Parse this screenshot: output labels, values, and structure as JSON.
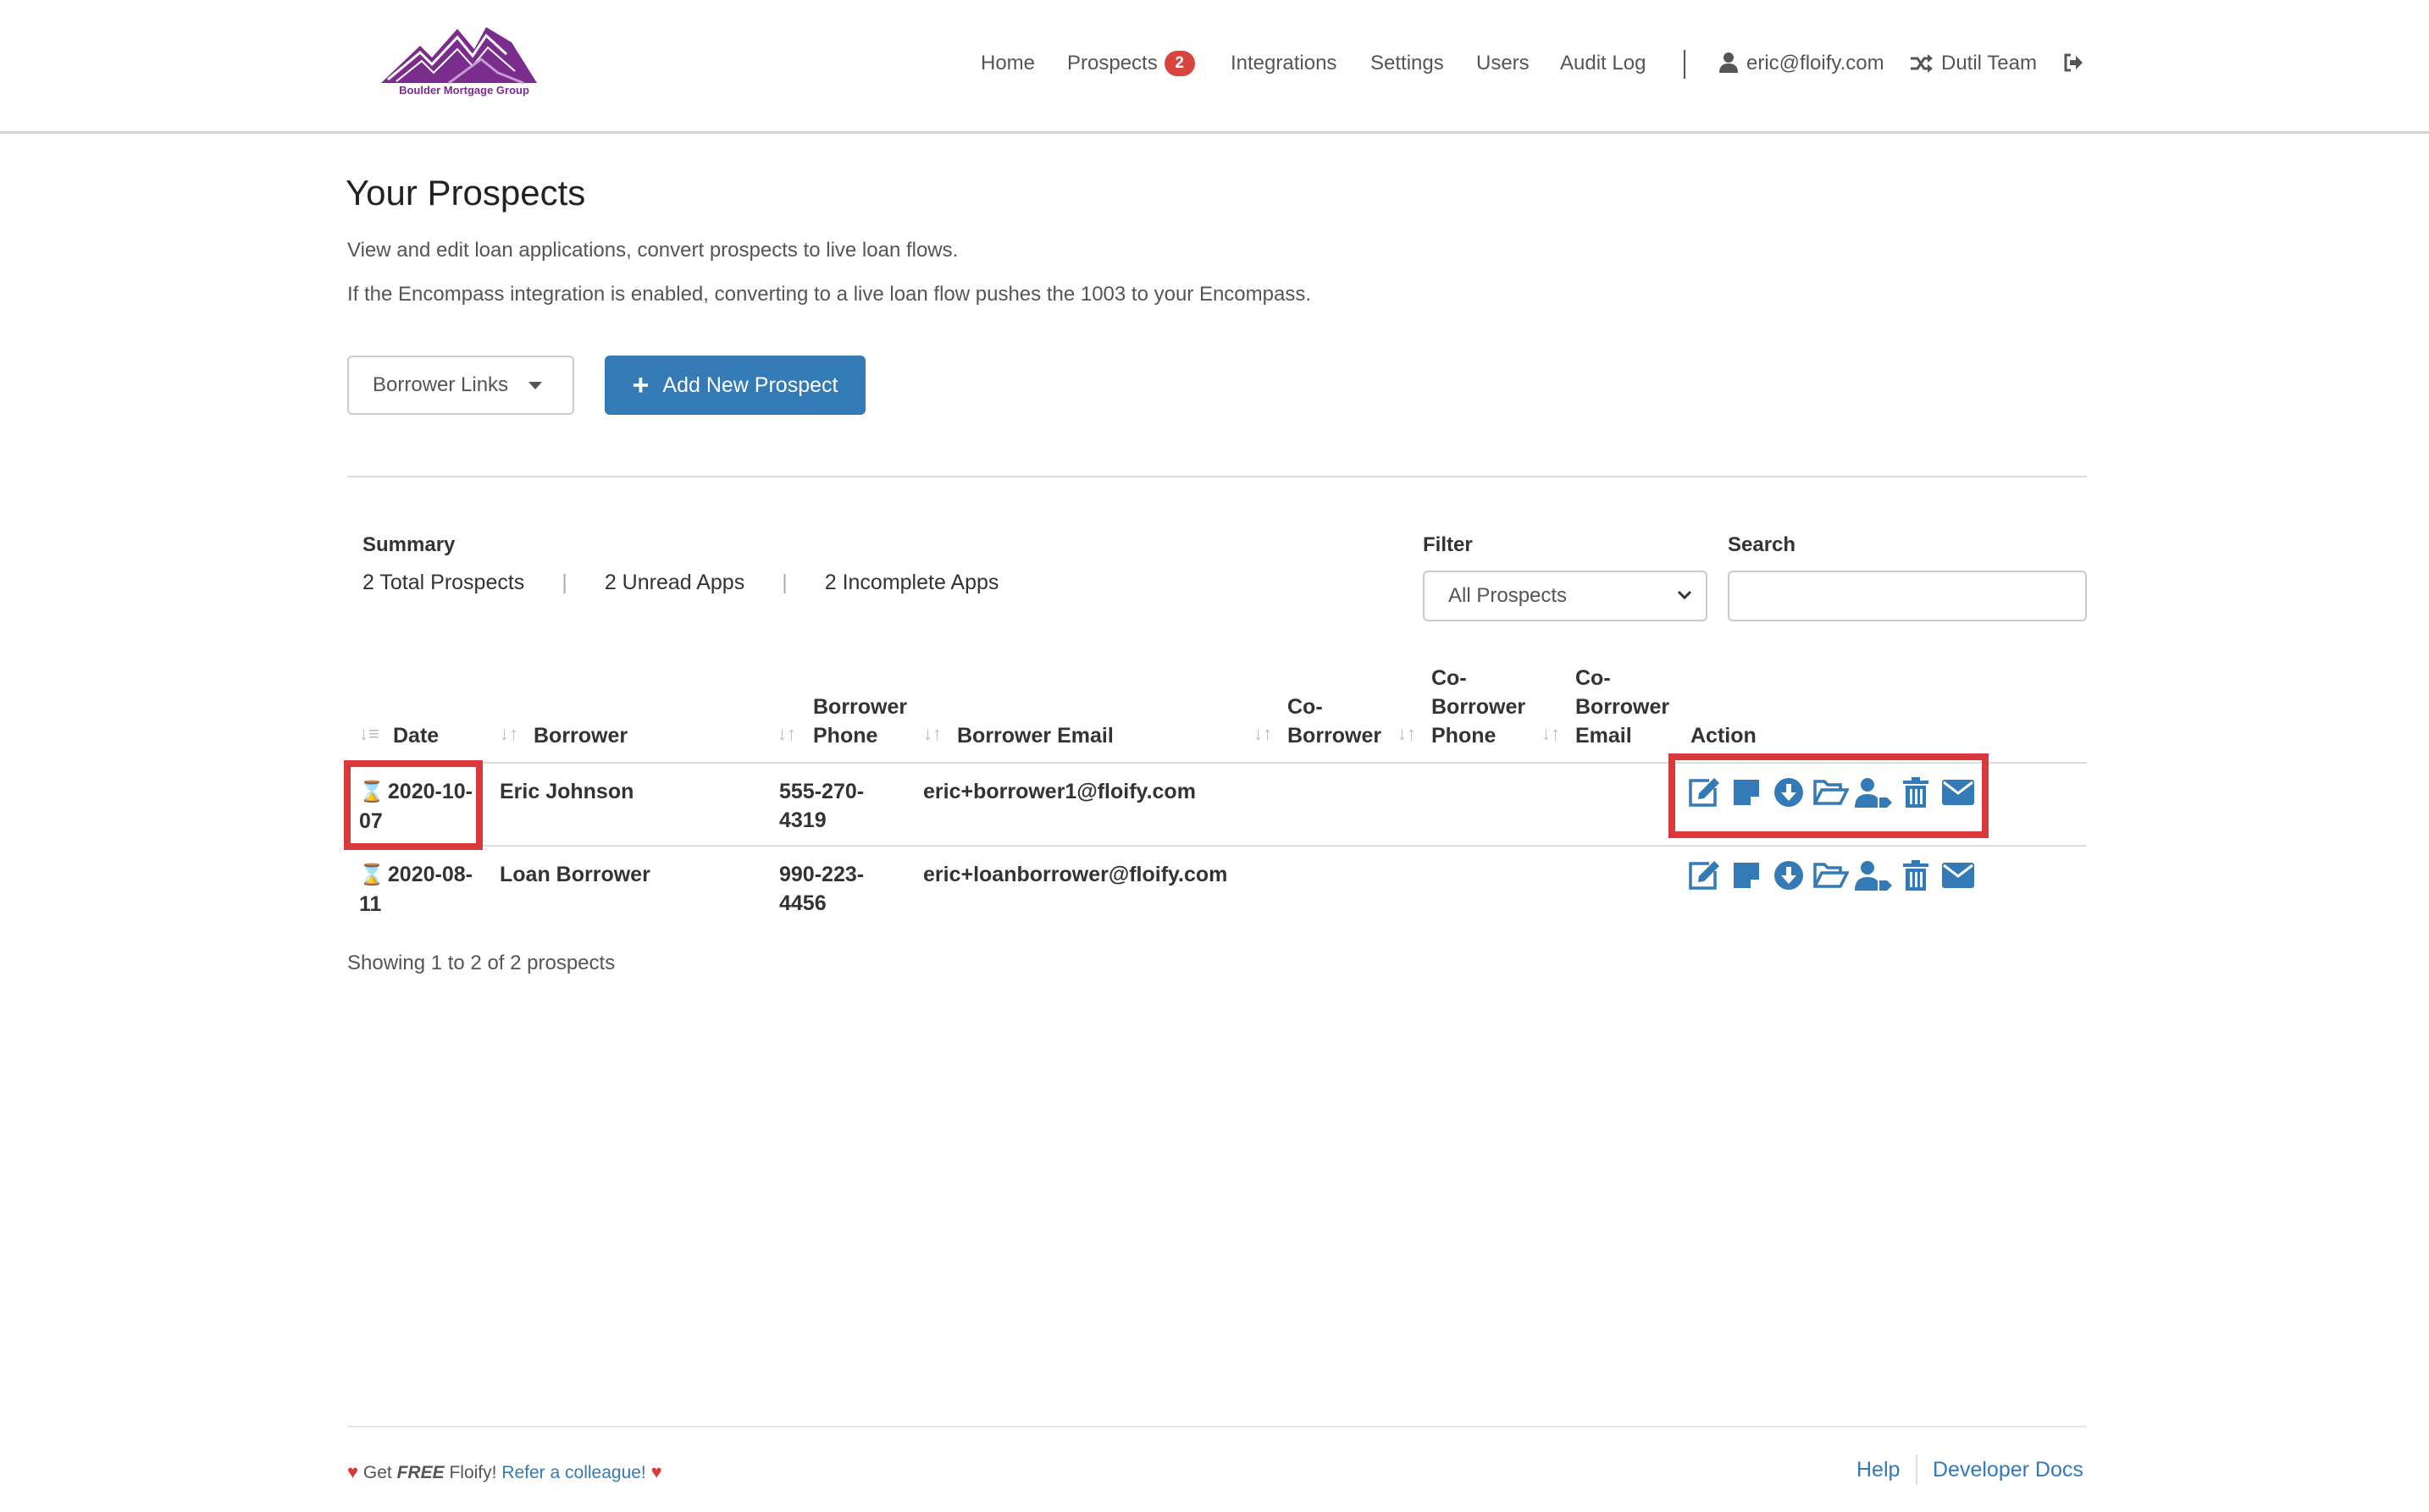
{
  "brand": {
    "logo_text": "Boulder Mortgage Group",
    "color": "#7a2d8c"
  },
  "nav": {
    "items": [
      "Home",
      "Prospects",
      "Integrations",
      "Settings",
      "Users",
      "Audit Log"
    ],
    "prospects_badge": "2",
    "user_email": "eric@floify.com",
    "team": "Dutil Team"
  },
  "page": {
    "title": "Your Prospects",
    "desc1": "View and edit loan applications, convert prospects to live loan flows.",
    "desc2": "If the Encompass integration is enabled, converting to a live loan flow pushes the 1003 to your Encompass."
  },
  "buttons": {
    "borrower_links": "Borrower Links",
    "add_prospect": "Add New Prospect"
  },
  "summary": {
    "label": "Summary",
    "total": "2 Total Prospects",
    "unread": "2 Unread Apps",
    "incomplete": "2 Incomplete Apps"
  },
  "filter": {
    "label": "Filter",
    "selected": "All Prospects"
  },
  "search": {
    "label": "Search",
    "value": ""
  },
  "table": {
    "headers": {
      "date": "Date",
      "borrower": "Borrower",
      "phone": [
        "Borrower",
        "Phone"
      ],
      "email": "Borrower Email",
      "coborrower": [
        "Co-",
        "Borrower"
      ],
      "cophone": [
        "Co-",
        "Borrower",
        "Phone"
      ],
      "coemail": [
        "Co-",
        "Borrower",
        "Email"
      ],
      "action": "Action"
    },
    "rows": [
      {
        "date_l1": "2020-10-",
        "date_l2": "07",
        "borrower": "Eric Johnson",
        "phone_l1": "555-270-",
        "phone_l2": "4319",
        "email": "eric+borrower1@floify.com"
      },
      {
        "date_l1": "2020-08-",
        "date_l2": "11",
        "borrower": "Loan Borrower",
        "phone_l1": "990-223-",
        "phone_l2": "4456",
        "email": "eric+loanborrower@floify.com"
      }
    ],
    "action_icons": [
      "edit-icon",
      "sticky-note-icon",
      "download-icon",
      "folder-open-icon",
      "user-tag-icon",
      "trash-icon",
      "envelope-icon"
    ]
  },
  "showing": "Showing 1 to 2 of 2 prospects",
  "footer": {
    "get": "Get",
    "free": "FREE",
    "floify": "Floify!",
    "refer": "Refer a colleague!",
    "help": "Help",
    "dev_docs": "Developer Docs"
  },
  "colors": {
    "primary": "#337ab7",
    "badge": "#d9443f",
    "highlight": "#d9383c"
  }
}
